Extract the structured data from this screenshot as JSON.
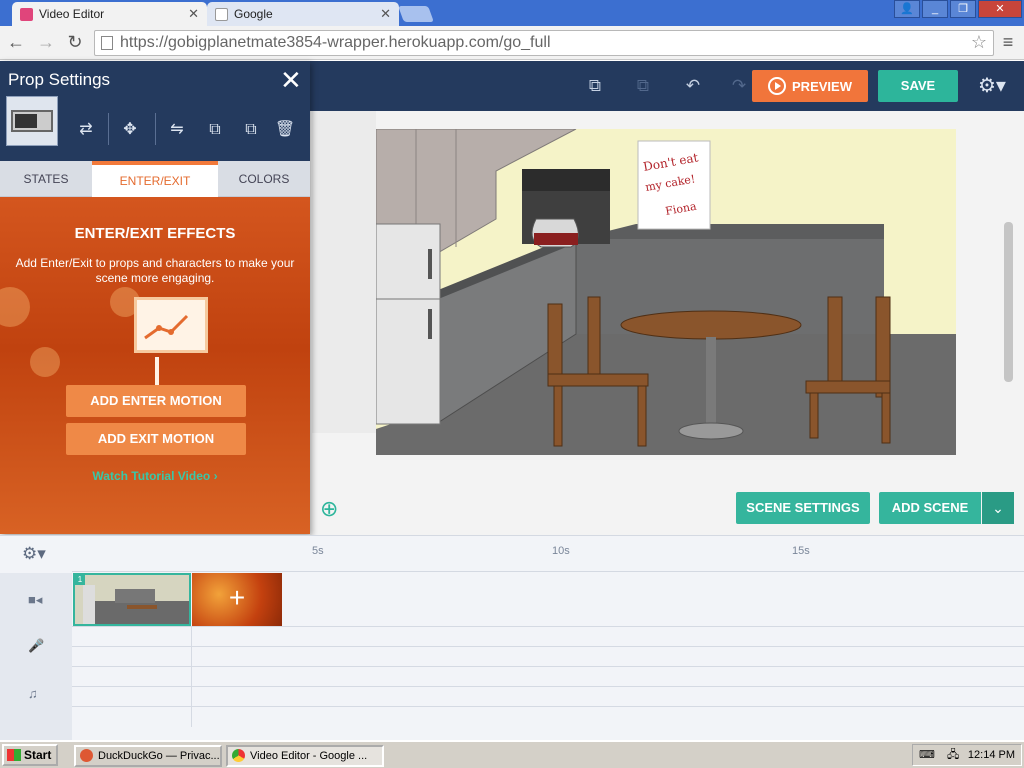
{
  "browser": {
    "tabs": [
      {
        "label": "Video Editor",
        "active": true
      },
      {
        "label": "Google",
        "active": false
      }
    ],
    "url": "https://gobigplanetmate3854-wrapper.herokuapp.com/go_full",
    "icons": {
      "back": "arrow-left-icon",
      "forward": "arrow-right-icon",
      "reload": "reload-icon",
      "bookmark": "star-icon",
      "menu": "hamburger-icon"
    }
  },
  "app": {
    "toolbar": {
      "preview_label": "PREVIEW",
      "save_label": "SAVE"
    },
    "panel": {
      "title": "Prop Settings",
      "tabs": [
        "STATES",
        "ENTER/EXIT",
        "COLORS"
      ],
      "active_tab": "ENTER/EXIT",
      "effects_title": "ENTER/EXIT EFFECTS",
      "effects_desc": "Add Enter/Exit to props and characters to make your scene more engaging.",
      "add_enter_label": "ADD ENTER MOTION",
      "add_exit_label": "ADD EXIT MOTION",
      "tutorial_label": "Watch Tutorial Video",
      "tutorial_arrow": "›"
    },
    "scene": {
      "note_text": "Don't eat my cake! Fiona"
    },
    "stage_buttons": {
      "scene_settings_label": "SCENE SETTINGS",
      "add_scene_label": "ADD SCENE"
    },
    "timeline": {
      "ticks": [
        "5s",
        "10s",
        "15s"
      ],
      "scene_number": "1",
      "add_label": "+"
    },
    "colors": {
      "navy": "#243a5e",
      "orange": "#f1753b",
      "teal": "#2db59b"
    }
  },
  "taskbar": {
    "start_label": "Start",
    "items": [
      {
        "label": "DuckDuckGo — Privac...",
        "active": false
      },
      {
        "label": "Video Editor - Google ...",
        "active": true
      }
    ],
    "clock": "12:14 PM"
  }
}
